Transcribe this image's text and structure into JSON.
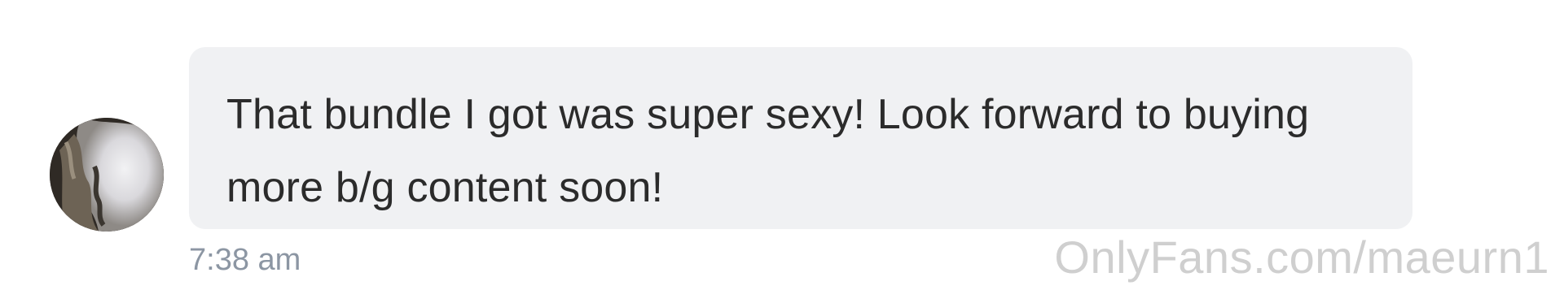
{
  "message": {
    "text": "That bundle I got was super sexy! Look forward to buying more b/g content soon!",
    "timestamp": "7:38 am",
    "avatar_icon": "user-avatar-photo"
  },
  "watermark": {
    "text": "OnlyFans.com/maeurn1"
  },
  "colors": {
    "bubble_background": "#f0f1f3",
    "message_text": "#2b2b2b",
    "timestamp_text": "#8c96a3",
    "watermark_text": "#cfcfcf"
  }
}
